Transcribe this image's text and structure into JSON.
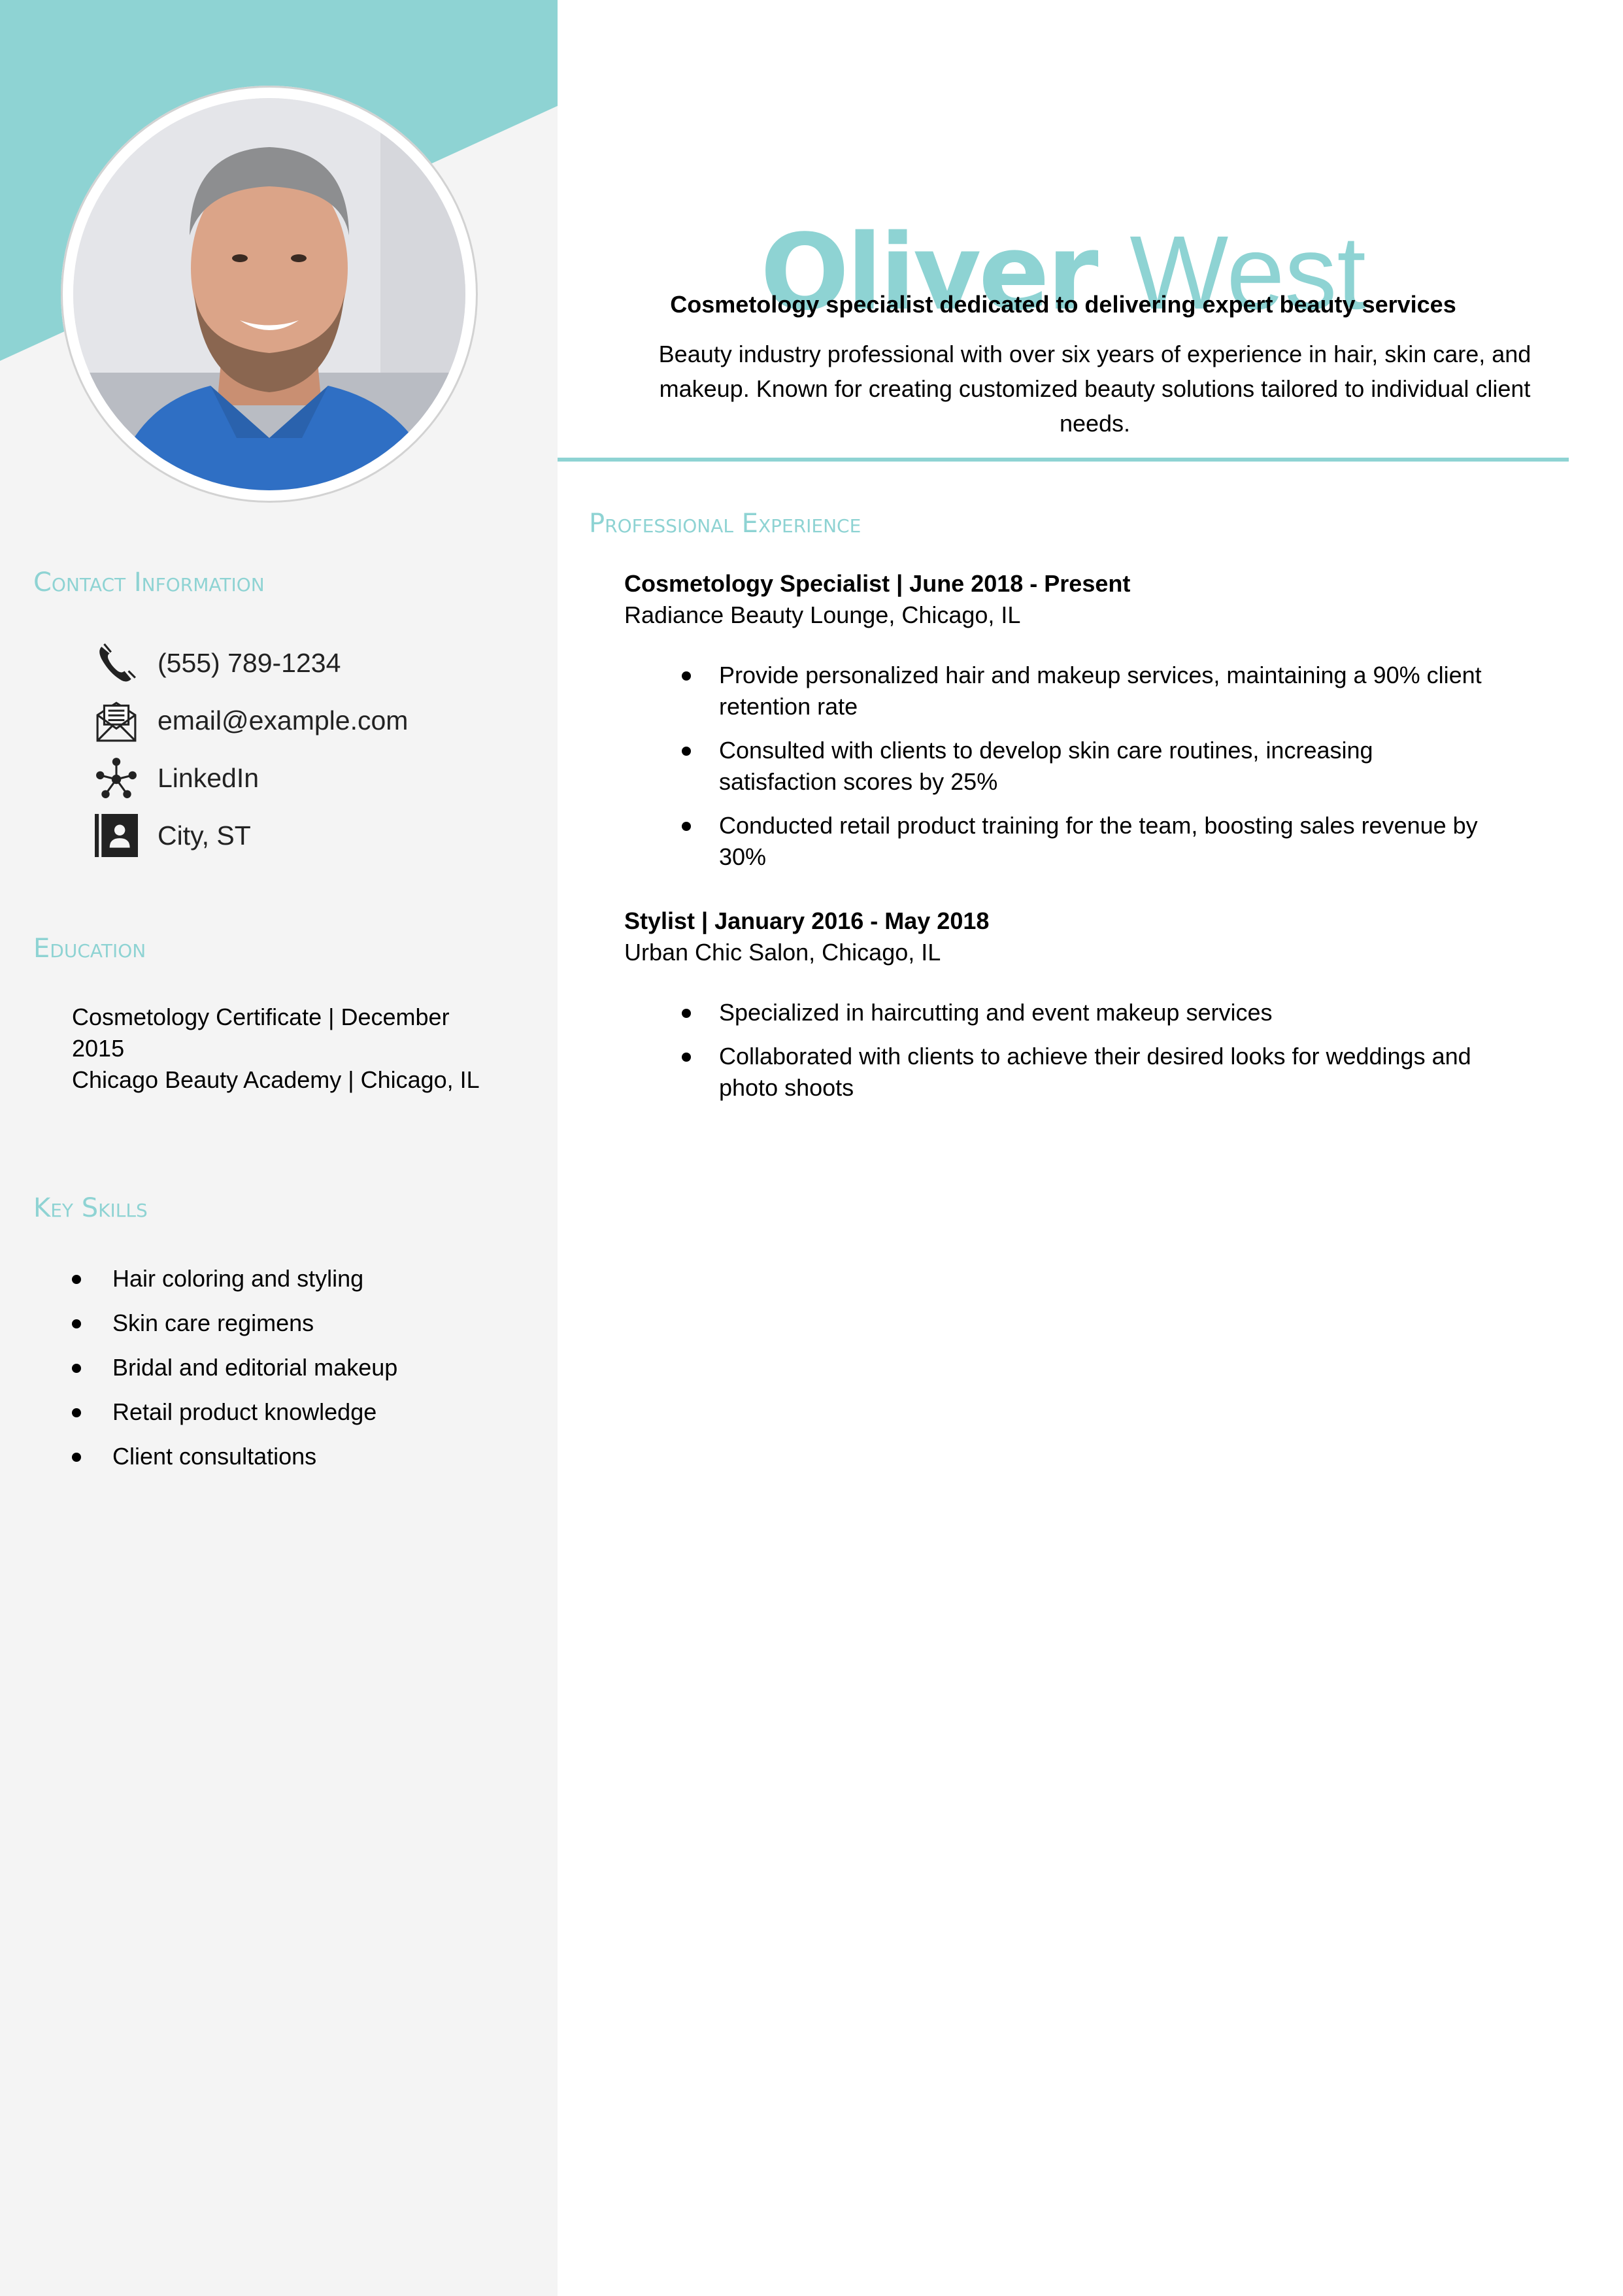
{
  "colors": {
    "accent": "#8ED3D3",
    "sidebar_bg": "#F4F4F4",
    "text": "#000000",
    "contact_text": "#222222"
  },
  "header": {
    "first_name": "Oliver",
    "last_name": "West",
    "tagline": "Cosmetology specialist dedicated to delivering expert beauty services",
    "summary": "Beauty industry professional with over six years of experience in hair, skin care, and makeup. Known for creating customized beauty solutions tailored to individual client needs."
  },
  "photo": {
    "alt": "Portrait of Oliver West"
  },
  "sidebar": {
    "contact": {
      "heading": "Contact Information",
      "items": [
        {
          "icon": "phone-icon",
          "text": "(555) 789-1234"
        },
        {
          "icon": "email-icon",
          "text": "email@example.com"
        },
        {
          "icon": "network-icon",
          "text": "LinkedIn"
        },
        {
          "icon": "address-book-icon",
          "text": "City, ST"
        }
      ]
    },
    "education": {
      "heading": "Education",
      "line1": "Cosmetology Certificate | December 2015",
      "line2": "Chicago Beauty Academy | Chicago, IL"
    },
    "skills": {
      "heading": "Key Skills",
      "items": [
        "Hair coloring and styling",
        "Skin care regimens",
        "Bridal and editorial makeup",
        "Retail product knowledge",
        "Client consultations"
      ]
    }
  },
  "experience": {
    "heading": "Professional Experience",
    "jobs": [
      {
        "title": "Cosmetology Specialist | June 2018 - Present",
        "company": "Radiance Beauty Lounge, Chicago, IL",
        "bullets": [
          "Provide personalized hair and makeup services, maintaining a 90% client retention rate",
          "Consulted with clients to develop skin care routines, increasing satisfaction scores by 25%",
          "Conducted retail product training for the team, boosting sales revenue by 30%"
        ]
      },
      {
        "title": "Stylist | January 2016 - May 2018",
        "company": "Urban Chic Salon, Chicago, IL",
        "bullets": [
          "Specialized in haircutting and event makeup services",
          "Collaborated with clients to achieve their desired looks for weddings and photo shoots"
        ]
      }
    ]
  }
}
